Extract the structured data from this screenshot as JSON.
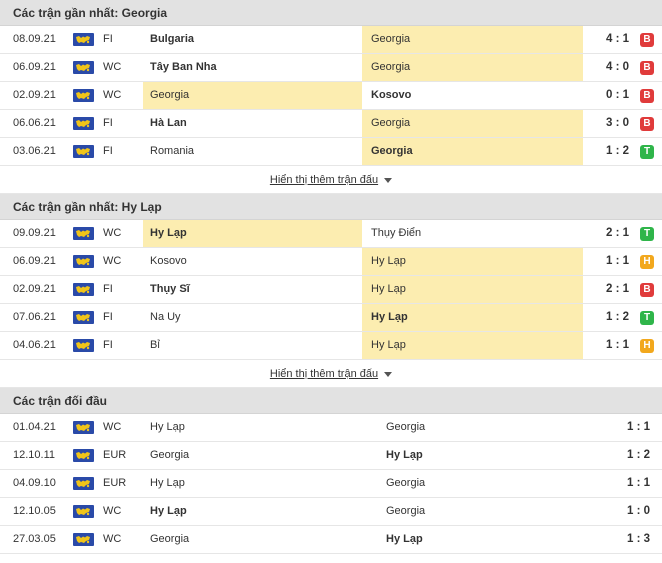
{
  "colors": {
    "win": "#2fb54a",
    "loss": "#e03b3b",
    "draw": "#f2a81d",
    "highlight": "#fcedb0"
  },
  "show_more_label": "Hiển thị thêm trận đấu",
  "sections": [
    {
      "title": "Các trận gần nhất: Georgia",
      "rows": [
        {
          "date": "08.09.21",
          "comp": "FI",
          "home": "Bulgaria",
          "away": "Georgia",
          "score": "4 : 1",
          "result": "B",
          "hl": "away",
          "bold": "home"
        },
        {
          "date": "06.09.21",
          "comp": "WC",
          "home": "Tây Ban Nha",
          "away": "Georgia",
          "score": "4 : 0",
          "result": "B",
          "hl": "away",
          "bold": "home"
        },
        {
          "date": "02.09.21",
          "comp": "WC",
          "home": "Georgia",
          "away": "Kosovo",
          "score": "0 : 1",
          "result": "B",
          "hl": "home",
          "bold": "away"
        },
        {
          "date": "06.06.21",
          "comp": "FI",
          "home": "Hà Lan",
          "away": "Georgia",
          "score": "3 : 0",
          "result": "B",
          "hl": "away",
          "bold": "home"
        },
        {
          "date": "03.06.21",
          "comp": "FI",
          "home": "Romania",
          "away": "Georgia",
          "score": "1 : 2",
          "result": "T",
          "hl": "away",
          "bold": "away"
        }
      ]
    },
    {
      "title": "Các trận gần nhất: Hy Lạp",
      "rows": [
        {
          "date": "09.09.21",
          "comp": "WC",
          "home": "Hy Lạp",
          "away": "Thụy Điển",
          "score": "2 : 1",
          "result": "T",
          "hl": "home",
          "bold": "home"
        },
        {
          "date": "06.09.21",
          "comp": "WC",
          "home": "Kosovo",
          "away": "Hy Lạp",
          "score": "1 : 1",
          "result": "H",
          "hl": "away",
          "bold": ""
        },
        {
          "date": "02.09.21",
          "comp": "FI",
          "home": "Thụy Sĩ",
          "away": "Hy Lạp",
          "score": "2 : 1",
          "result": "B",
          "hl": "away",
          "bold": "home"
        },
        {
          "date": "07.06.21",
          "comp": "FI",
          "home": "Na Uy",
          "away": "Hy Lạp",
          "score": "1 : 2",
          "result": "T",
          "hl": "away",
          "bold": "away"
        },
        {
          "date": "04.06.21",
          "comp": "FI",
          "home": "Bỉ",
          "away": "Hy Lạp",
          "score": "1 : 1",
          "result": "H",
          "hl": "away",
          "bold": ""
        }
      ]
    }
  ],
  "h2h": {
    "title": "Các trận đối đầu",
    "rows": [
      {
        "date": "01.04.21",
        "comp": "WC",
        "home": "Hy Lạp",
        "away": "Georgia",
        "score": "1 : 1",
        "bold": ""
      },
      {
        "date": "12.10.11",
        "comp": "EUR",
        "home": "Georgia",
        "away": "Hy Lạp",
        "score": "1 : 2",
        "bold": "away"
      },
      {
        "date": "04.09.10",
        "comp": "EUR",
        "home": "Hy Lạp",
        "away": "Georgia",
        "score": "1 : 1",
        "bold": ""
      },
      {
        "date": "12.10.05",
        "comp": "WC",
        "home": "Hy Lạp",
        "away": "Georgia",
        "score": "1 : 0",
        "bold": "home"
      },
      {
        "date": "27.03.05",
        "comp": "WC",
        "home": "Georgia",
        "away": "Hy Lạp",
        "score": "1 : 3",
        "bold": "away"
      }
    ]
  }
}
